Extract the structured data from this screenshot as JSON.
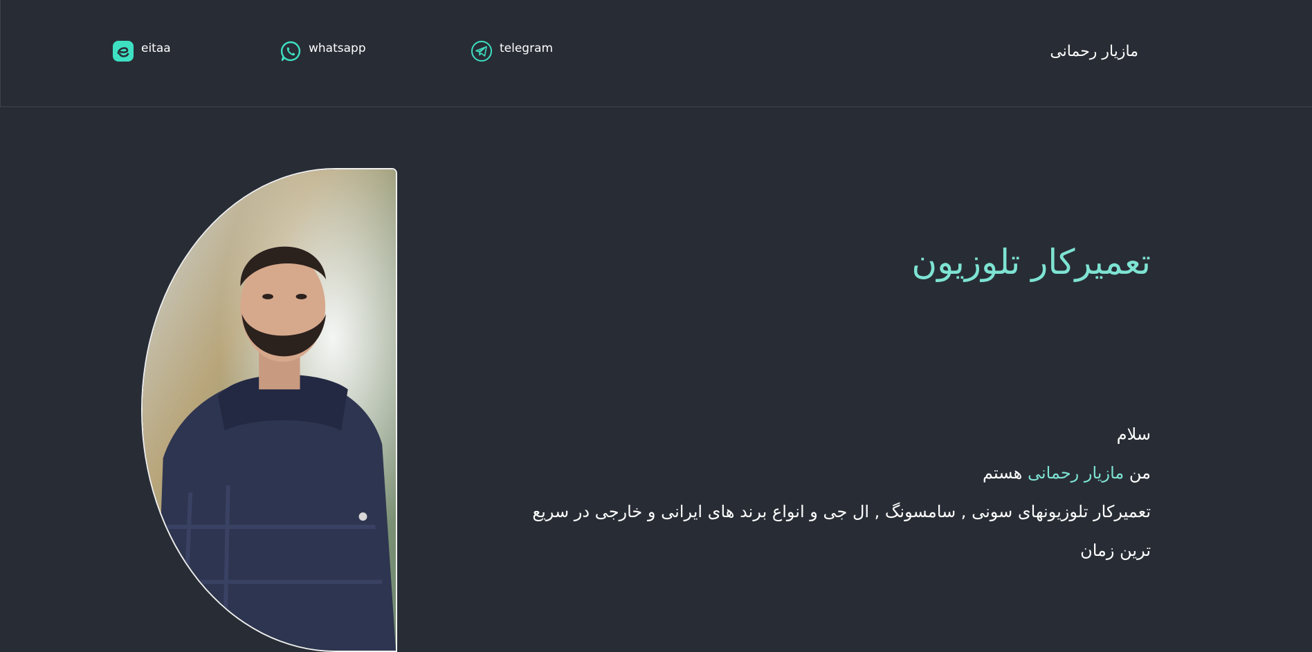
{
  "header": {
    "site_name": "مازیار رحمانی",
    "socials": [
      {
        "label": "eitaa",
        "icon": "eitaa-icon"
      },
      {
        "label": "whatsapp",
        "icon": "whatsapp-icon"
      },
      {
        "label": "telegram",
        "icon": "telegram-icon"
      }
    ]
  },
  "hero": {
    "title": "تعمیرکار تلوزیون",
    "greeting": "سلام",
    "intro_prefix": "من",
    "intro_name": "مازیار رحمانی",
    "intro_suffix": "هستم",
    "description": "تعمیرکار تلوزیونهای سونی , سامسونگ , ال جی و انواع برند های ایرانی و خارجی در سریع ترین زمان"
  },
  "colors": {
    "background": "#282d35",
    "accent": "#7ee3d3",
    "icon": "#3ee0c2"
  }
}
